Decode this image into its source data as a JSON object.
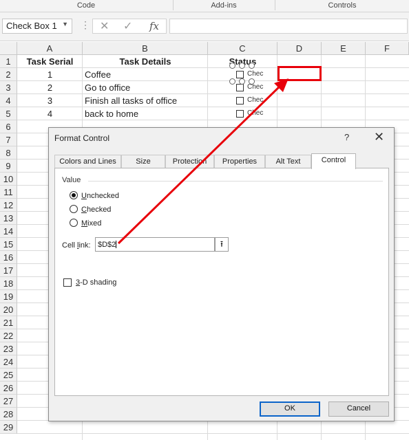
{
  "ribbon": {
    "groups": [
      "Code",
      "Add-ins",
      "Controls"
    ]
  },
  "formula_bar": {
    "name_box": "Check Box 1",
    "cancel_icon": "x-icon",
    "enter_icon": "check-icon",
    "fx": "fx",
    "formula": ""
  },
  "sheet": {
    "columns": [
      "A",
      "B",
      "C",
      "D",
      "E",
      "F"
    ],
    "rows": [
      "1",
      "2",
      "3",
      "4",
      "5",
      "6",
      "7",
      "8",
      "9",
      "10",
      "11",
      "12",
      "13",
      "14",
      "15",
      "16",
      "17",
      "18",
      "19",
      "20",
      "21",
      "22",
      "23",
      "24",
      "25",
      "26",
      "27",
      "28",
      "29"
    ],
    "headers": {
      "a": "Task Serial",
      "b": "Task Details",
      "c": "Status"
    },
    "data": [
      {
        "serial": "1",
        "task": "Coffee",
        "check_label": "Chec"
      },
      {
        "serial": "2",
        "task": "Go to office",
        "check_label": "Chec"
      },
      {
        "serial": "3",
        "task": "Finish all tasks of office",
        "check_label": "Chec"
      },
      {
        "serial": "4",
        "task": "back to home",
        "check_label": "Chec"
      }
    ]
  },
  "annotation": {
    "highlight_color": "#e8000a"
  },
  "dialog": {
    "title": "Format Control",
    "help": "?",
    "close": "✕",
    "tabs": [
      "Colors and Lines",
      "Size",
      "Protection",
      "Properties",
      "Alt Text",
      "Control"
    ],
    "active_tab": "Control",
    "value_group": "Value",
    "options": [
      {
        "label": "Unchecked",
        "selected": true
      },
      {
        "label": "Checked",
        "selected": false
      },
      {
        "label": "Mixed",
        "selected": false
      }
    ],
    "cell_link_label": "Cell link:",
    "cell_link_value": "$D$2",
    "shading_label": "3-D shading",
    "shading_checked": false,
    "ok": "OK",
    "cancel": "Cancel"
  }
}
